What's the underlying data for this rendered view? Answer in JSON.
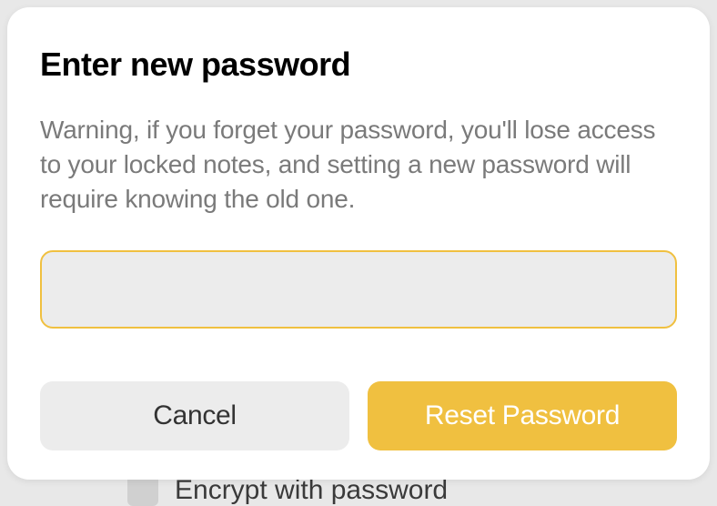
{
  "modal": {
    "title": "Enter new password",
    "warning": "Warning, if you forget your password, you'll lose access to your locked notes, and setting a new password will require knowing the old one.",
    "password_value": "",
    "cancel_label": "Cancel",
    "reset_label": "Reset Password"
  },
  "background": {
    "hint_text": "Encrypt with password"
  }
}
